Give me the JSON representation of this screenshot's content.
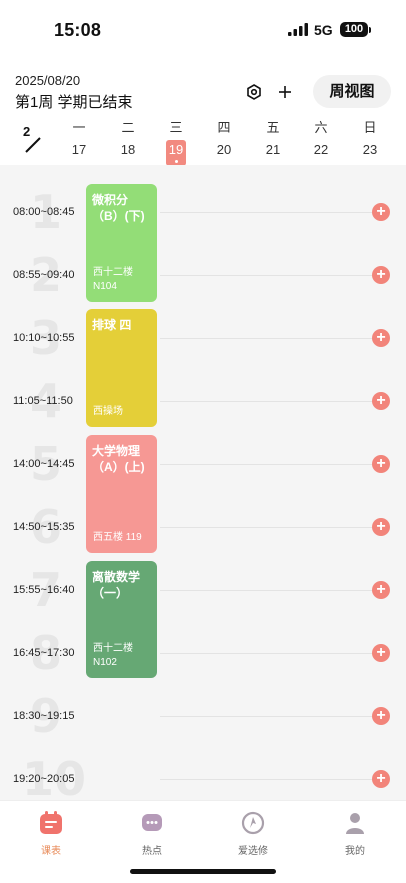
{
  "status": {
    "time": "15:08",
    "network": "5G",
    "battery": "100"
  },
  "header": {
    "date": "2025/08/20",
    "week_status": "第1周 学期已结束",
    "view_button": "周视图"
  },
  "month": "2",
  "days": [
    {
      "weekday": "一",
      "date": "17"
    },
    {
      "weekday": "二",
      "date": "18"
    },
    {
      "weekday": "三",
      "date": "19"
    },
    {
      "weekday": "四",
      "date": "20"
    },
    {
      "weekday": "五",
      "date": "21"
    },
    {
      "weekday": "六",
      "date": "22"
    },
    {
      "weekday": "日",
      "date": "23"
    }
  ],
  "slots": [
    {
      "num": "1",
      "time": "08:00~08:45"
    },
    {
      "num": "2",
      "time": "08:55~09:40"
    },
    {
      "num": "3",
      "time": "10:10~10:55"
    },
    {
      "num": "4",
      "time": "11:05~11:50"
    },
    {
      "num": "5",
      "time": "14:00~14:45"
    },
    {
      "num": "6",
      "time": "14:50~15:35"
    },
    {
      "num": "7",
      "time": "15:55~16:40"
    },
    {
      "num": "8",
      "time": "16:45~17:30"
    },
    {
      "num": "9",
      "time": "18:30~19:15"
    },
    {
      "num": "10",
      "time": "19:20~20:05"
    }
  ],
  "courses": [
    {
      "name": "微积分（B）(下)",
      "room": "西十二楼 N104",
      "color": "#93dd77"
    },
    {
      "name": "排球  四",
      "room": "西操场",
      "color": "#e4cf38"
    },
    {
      "name": "大学物理（A）(上)",
      "room": "西五楼 119",
      "color": "#f69894"
    },
    {
      "name": "离散数学（一）",
      "room": "西十二楼 N102",
      "color": "#66a874"
    }
  ],
  "tabs": [
    {
      "label": "课表"
    },
    {
      "label": "热点"
    },
    {
      "label": "爱选修"
    },
    {
      "label": "我的"
    }
  ],
  "colors": {
    "accent": "#f2847a",
    "tab_active": "#e88a58"
  }
}
